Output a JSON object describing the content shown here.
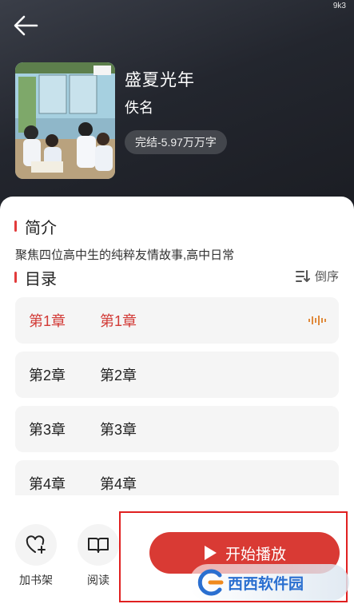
{
  "status": {
    "indicator": "9k3"
  },
  "book": {
    "title": "盛夏光年",
    "author": "佚名",
    "status": "完结-5.97万万字"
  },
  "intro": {
    "heading": "简介",
    "text": "聚焦四位高中生的纯粹友情故事,高中日常"
  },
  "catalog": {
    "heading": "目录",
    "sort_label": "倒序",
    "chapters": [
      {
        "no": "第1章",
        "name": "第1章",
        "active": true
      },
      {
        "no": "第2章",
        "name": "第2章",
        "active": false
      },
      {
        "no": "第3章",
        "name": "第3章",
        "active": false
      },
      {
        "no": "第4章",
        "name": "第4章",
        "active": false
      }
    ]
  },
  "actions": {
    "bookshelf_label": "加书架",
    "read_label": "阅读",
    "play_label": "开始播放"
  },
  "watermark": {
    "text": "西西软件园"
  },
  "colors": {
    "accent": "#d93a34",
    "header_bg": "#23262e",
    "chapter_bg": "#f5f5f5"
  }
}
